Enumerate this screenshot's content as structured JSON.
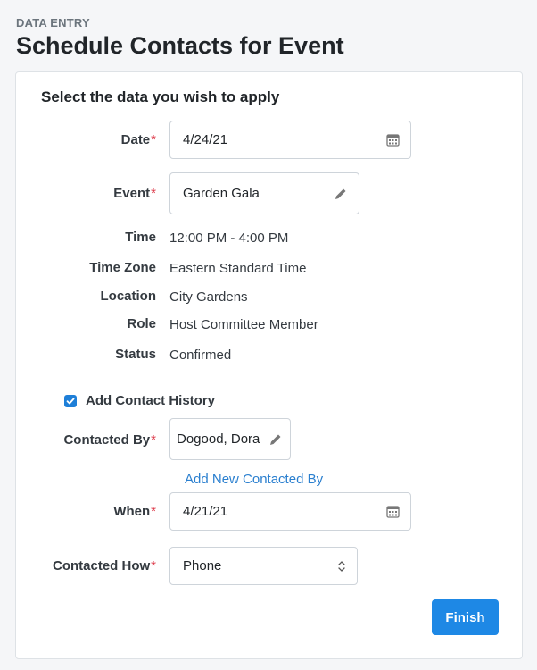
{
  "header": {
    "eyebrow": "DATA ENTRY",
    "title": "Schedule Contacts for Event"
  },
  "form": {
    "heading": "Select the data you wish to apply",
    "required_marker": "*",
    "date": {
      "label": "Date",
      "value": "4/24/21",
      "icon": "calendar-icon"
    },
    "event": {
      "label": "Event",
      "value": "Garden Gala",
      "icon": "pencil-icon"
    },
    "details": {
      "time": {
        "label": "Time",
        "value": "12:00 PM - 4:00 PM"
      },
      "time_zone": {
        "label": "Time Zone",
        "value": "Eastern Standard Time"
      },
      "location": {
        "label": "Location",
        "value": "City Gardens"
      },
      "role": {
        "label": "Role",
        "value": "Host Committee Member"
      },
      "status": {
        "label": "Status",
        "value": "Confirmed"
      }
    },
    "add_contact_history": {
      "label": "Add Contact History",
      "checked": true
    },
    "contacted_by": {
      "label": "Contacted By",
      "value": "Dogood, Dora",
      "icon": "pencil-icon"
    },
    "add_new_contacted_by": "Add New Contacted By",
    "when": {
      "label": "When",
      "value": "4/21/21",
      "icon": "calendar-icon"
    },
    "contacted_how": {
      "label": "Contacted How",
      "value": "Phone",
      "icon": "chevron-up-down-icon"
    },
    "finish_label": "Finish"
  },
  "colors": {
    "accent": "#1e88e5",
    "link": "#2a7fcf",
    "required": "#dc3545"
  }
}
